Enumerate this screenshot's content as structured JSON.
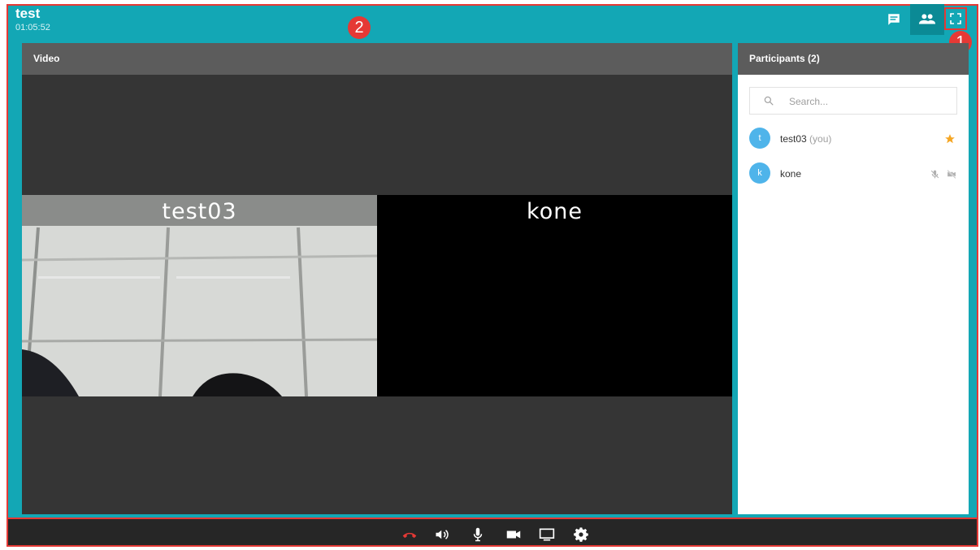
{
  "room": {
    "title": "test",
    "elapsed": "01:05:52"
  },
  "annotations": {
    "badge_1": "1",
    "badge_2": "2"
  },
  "video": {
    "header": "Video",
    "tiles": [
      {
        "name": "test03"
      },
      {
        "name": "kone"
      }
    ]
  },
  "participants": {
    "header": "Participants (2)",
    "search_placeholder": "Search...",
    "list": [
      {
        "initial": "t",
        "name": "test03",
        "suffix": "(you)",
        "role_icon": "star-icon"
      },
      {
        "initial": "k",
        "name": "kone",
        "suffix": "",
        "status_icons": [
          "mic-off-icon",
          "video-off-icon"
        ]
      }
    ]
  },
  "toolbar": {
    "icons": [
      "hangup-icon",
      "volume-icon",
      "mic-icon",
      "camera-icon",
      "screen-share-icon",
      "settings-icon"
    ]
  },
  "colors": {
    "accent": "#13a7b5",
    "header_gray": "#5c5c5c",
    "stage": "#353535",
    "hangup": "#e53935",
    "avatar": "#4fb4ea",
    "star": "#f5a623"
  }
}
